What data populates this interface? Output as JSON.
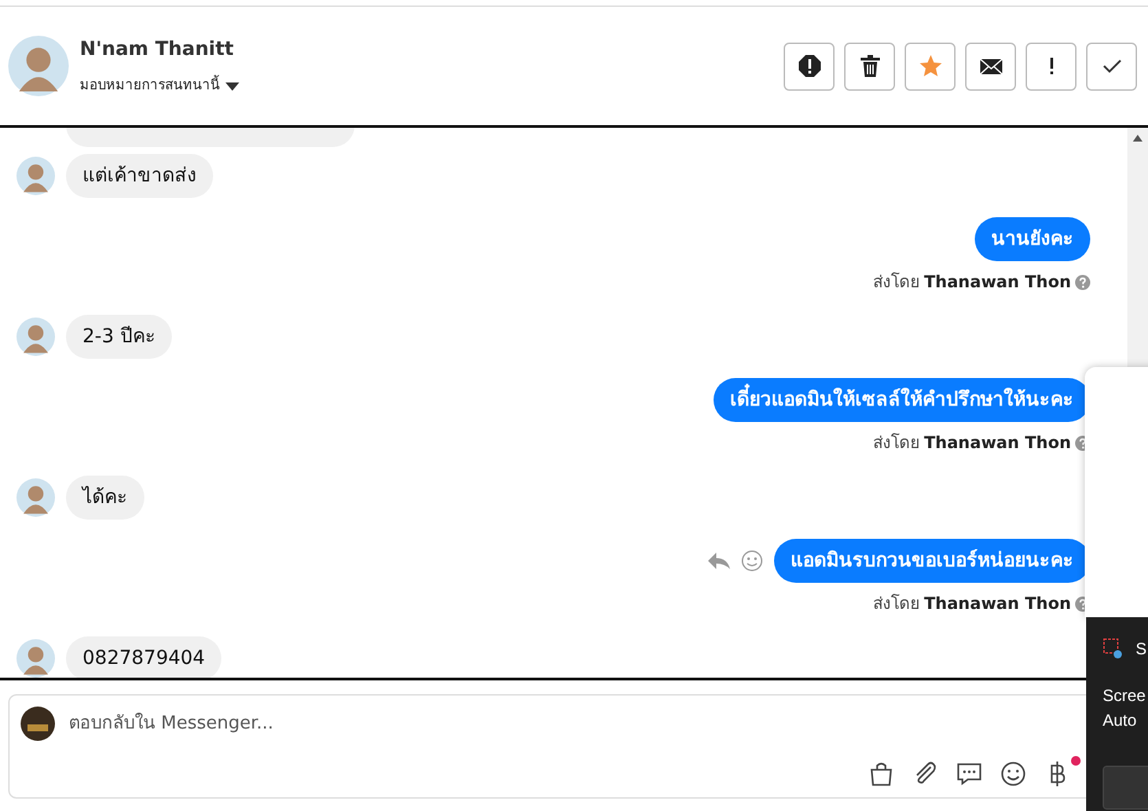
{
  "header": {
    "name": "N'nam Thanitt",
    "assign_label": "มอบหมายการสนทนานี้",
    "actions": [
      {
        "kind": "spam"
      },
      {
        "kind": "delete"
      },
      {
        "kind": "star"
      },
      {
        "kind": "mail"
      },
      {
        "kind": "important"
      },
      {
        "kind": "done"
      }
    ]
  },
  "messages": [
    {
      "kind": "fragment"
    },
    {
      "kind": "incoming",
      "text": "แต่เค้าขาดส่ง"
    },
    {
      "kind": "outgoing",
      "text": "นานยังคะ",
      "sent_by_label": "ส่งโดย",
      "sender": "Thanawan Thon",
      "hover_actions": false
    },
    {
      "kind": "incoming",
      "text": "2-3 ปีคะ"
    },
    {
      "kind": "outgoing",
      "text": "เดี๋ยวแอดมินให้เซลล์ให้คำปรึกษาให้นะคะ",
      "sent_by_label": "ส่งโดย",
      "sender": "Thanawan Thon",
      "hover_actions": false
    },
    {
      "kind": "incoming",
      "text": "ได้คะ"
    },
    {
      "kind": "outgoing",
      "text": "แอดมินรบกวนขอเบอร์หน่อยนะคะ",
      "sent_by_label": "ส่งโดย",
      "sender": "Thanawan Thon",
      "hover_actions": true
    },
    {
      "kind": "incoming",
      "text": "0827879404"
    }
  ],
  "composer": {
    "placeholder": "ตอบกลับใน Messenger...",
    "tools": [
      {
        "kind": "bag",
        "badge": false
      },
      {
        "kind": "attach",
        "badge": false
      },
      {
        "kind": "reply",
        "badge": false
      },
      {
        "kind": "emoji",
        "badge": false
      },
      {
        "kind": "baht",
        "badge": true
      }
    ]
  },
  "notification": {
    "title": "S",
    "lines": [
      "Scree",
      "Auto"
    ]
  }
}
